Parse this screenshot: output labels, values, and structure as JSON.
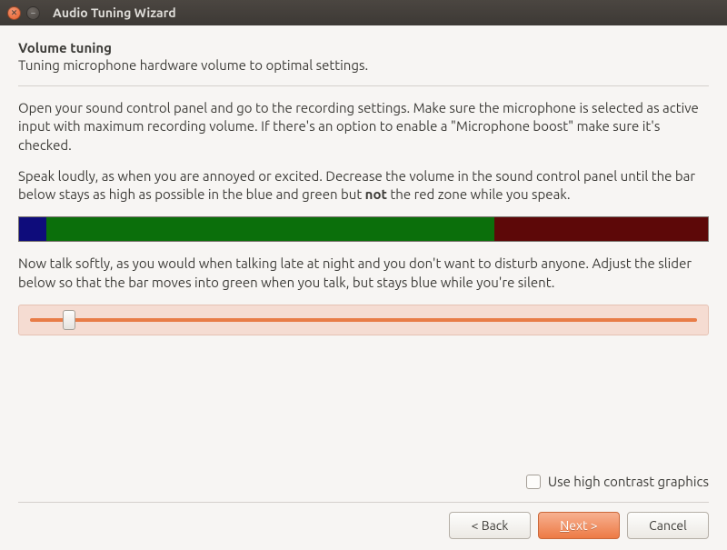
{
  "window": {
    "title": "Audio Tuning Wizard"
  },
  "page": {
    "heading": "Volume tuning",
    "subheading": "Tuning microphone hardware volume to optimal settings.",
    "para1": "Open your sound control panel and go to the recording settings. Make sure the microphone is selected as active input with maximum recording volume. If there's an option to enable a \"Microphone boost\" make sure it's checked.",
    "para2_pre": "Speak loudly, as when you are annoyed or excited. Decrease the volume in the sound control panel until the bar below stays as high as possible in the blue and green but ",
    "para2_bold": "not",
    "para2_post": " the red zone while you speak.",
    "para3": "Now talk softly, as you would when talking late at night and you don't want to disturb anyone. Adjust the slider below so that the bar moves into green when you talk, but stays blue while you're silent."
  },
  "volume_bar": {
    "blue_pct": 4,
    "green_pct": 65,
    "red_pct": 31
  },
  "slider": {
    "value_pct": 5
  },
  "checkbox": {
    "label": "Use high contrast graphics",
    "checked": false
  },
  "buttons": {
    "back": "< Back",
    "next_prefix": "N",
    "next_rest": "ext >",
    "cancel": "Cancel"
  }
}
